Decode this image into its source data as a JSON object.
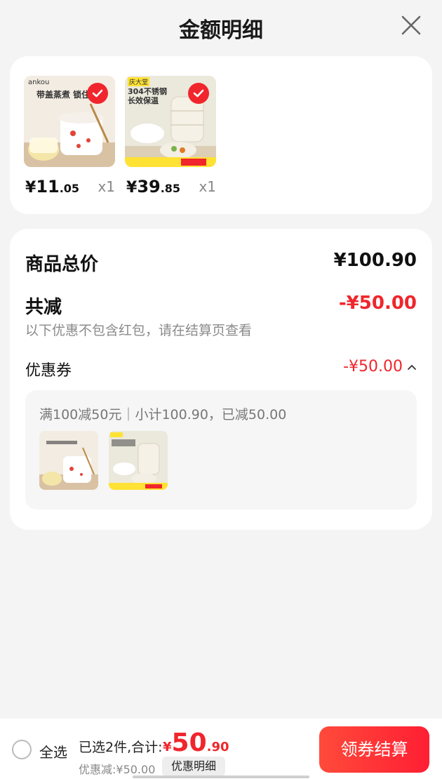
{
  "header": {
    "title": "金额明细"
  },
  "products": [
    {
      "price_yen": "¥",
      "price_int": "11",
      "price_dec": ".05",
      "qty": "x1",
      "selected": true,
      "thumb_brand": "ankou",
      "thumb_text": "带盖蒸煮 锁住营"
    },
    {
      "price_yen": "¥",
      "price_int": "39",
      "price_dec": ".85",
      "qty": "x1",
      "selected": true,
      "thumb_brand": "庆大堂",
      "thumb_text": "304不锈钢 长效保温"
    }
  ],
  "summary": {
    "total_label": "商品总价",
    "total_value": "¥100.90",
    "reduce_label": "共减",
    "reduce_value": "-¥50.00",
    "hint": "以下优惠不包含红包，请在结算页查看",
    "coupon_label": "优惠券",
    "coupon_value": "-¥50.00",
    "promo_text": "满100减50元｜小计100.90，已减50.00"
  },
  "bottom": {
    "select_all": "全选",
    "selected_info": "已选2件,合计:",
    "total_yen": "¥",
    "total_int": "50",
    "total_dec": ".90",
    "discount_info": "优惠减:¥50.00",
    "detail_button": "优惠明细",
    "checkout_button": "领券结算"
  },
  "colors": {
    "accent_red": "#f0262c",
    "background": "#f4f4f4",
    "card": "#ffffff"
  }
}
